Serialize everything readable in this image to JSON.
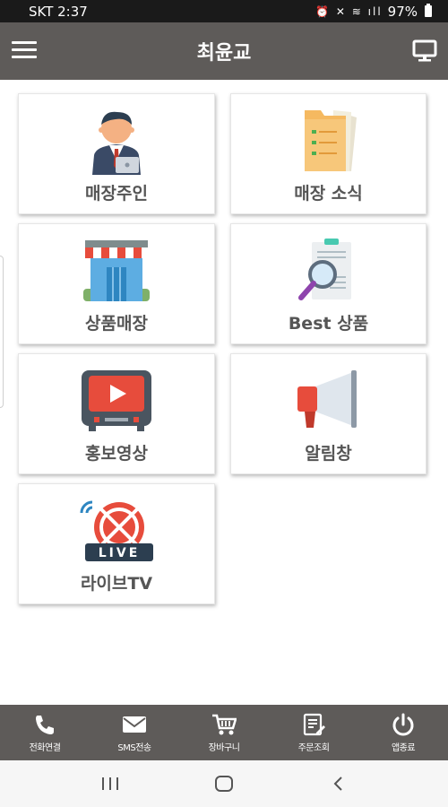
{
  "status_bar": {
    "carrier_time": "SKT 2:37",
    "battery": "97%"
  },
  "header": {
    "title": "최윤교"
  },
  "tiles": [
    {
      "label": "매장주인",
      "icon": "shop-owner-icon"
    },
    {
      "label": "매장 소식",
      "icon": "folder-news-icon"
    },
    {
      "label": "상품매장",
      "icon": "storefront-icon"
    },
    {
      "label": "Best 상품",
      "icon": "magnifier-document-icon"
    },
    {
      "label": "홍보영상",
      "icon": "video-play-icon"
    },
    {
      "label": "알림창",
      "icon": "megaphone-icon"
    },
    {
      "label": "라이브TV",
      "icon": "live-tv-icon"
    }
  ],
  "bottom_nav": [
    {
      "label": "전화연결",
      "icon": "phone-icon"
    },
    {
      "label": "SMS전송",
      "icon": "mail-icon"
    },
    {
      "label": "장바구니",
      "icon": "cart-icon"
    },
    {
      "label": "주문조회",
      "icon": "order-icon"
    },
    {
      "label": "앱종료",
      "icon": "power-icon"
    }
  ],
  "colors": {
    "header_bg": "#5e5b59",
    "status_bg": "#1a1a1a",
    "tile_text": "#555555"
  }
}
